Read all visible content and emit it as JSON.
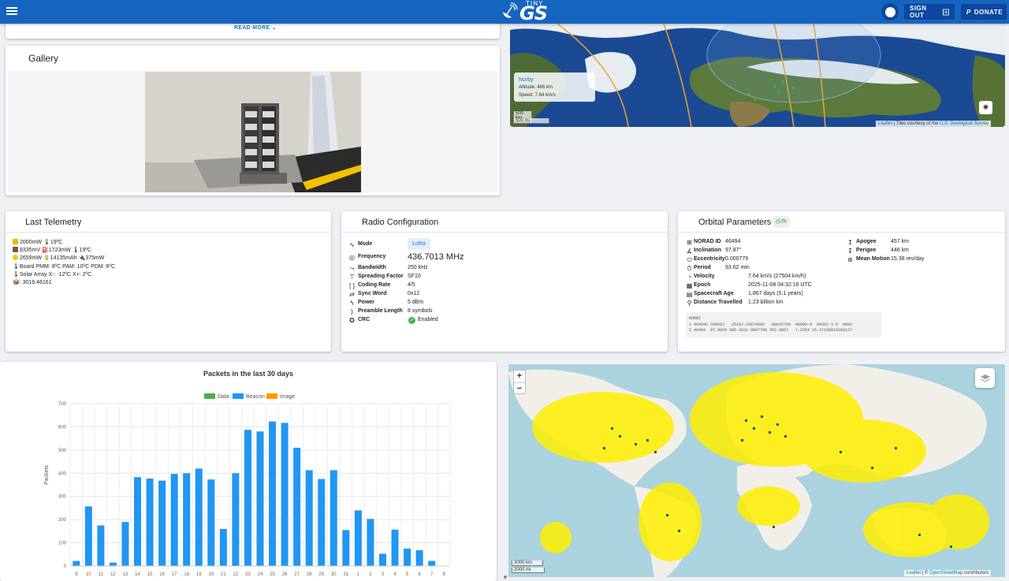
{
  "topbar": {
    "logo_top": "TINY",
    "logo_main": "GS",
    "signout_label": "SIGN OUT",
    "donate_label": "DONATE"
  },
  "description_card": {
    "read_more": "READ MORE ⌄"
  },
  "gallery": {
    "title": "Gallery"
  },
  "tracker_map": {
    "popup": {
      "name": "Norby",
      "altitude": "Altitude: 466 km",
      "speed": "Speed: 7.64 km/s"
    },
    "scale_km": "500 km",
    "scale_mi": "500 mi",
    "attribution_link": "Leaflet",
    "attribution_text": " | Tiles courtesy of the ",
    "attribution_link2": "U.S. Geological Survey"
  },
  "telemetry": {
    "title": "Last Telemetry",
    "rows": [
      "2000mW 🌡19ºC",
      "8335mV ⛽1723mW 🌡19ºC",
      "2659mW 🔋14135mAh 🔌375mW",
      "🌡Board PMM: 8ºC PAM: 10ºC PDM: 6ºC",
      "🌡Solar Array X-: -12ºC X+: 2ºC",
      "📦: 3019.46161"
    ]
  },
  "radio": {
    "title": "Radio Configuration",
    "mode_label": "Mode",
    "mode_value": "LoRa",
    "frequency_label": "Frequency",
    "frequency_value": "436.7013 MHz",
    "bandwidth_label": "Bandwidth",
    "bandwidth_value": "250 kHz",
    "sf_label": "Spreading Factor",
    "sf_value": "SF10",
    "cr_label": "Coding Rate",
    "cr_value": "4/5",
    "sync_label": "Sync Word",
    "sync_value": "0x12",
    "power_label": "Power",
    "power_value": "5 dBm",
    "preamble_label": "Preamble Length",
    "preamble_value": "8 symbols",
    "crc_label": "CRC",
    "crc_value": "Enabled"
  },
  "orbital": {
    "title": "Orbital Parameters",
    "age_badge": "7h",
    "norad_label": "NORAD ID",
    "norad_value": "46494",
    "incl_label": "Inclination",
    "incl_value": "97.87°",
    "ecc_label": "Eccentricity",
    "ecc_value": "0.000779",
    "period_label": "Period",
    "period_value": "93.62 min",
    "velocity_label": "Velocity",
    "velocity_value": "7.64 km/s (27504 km/h)",
    "epoch_label": "Epoch",
    "epoch_value": "2025-11-08 04:32:16 UTC",
    "age_label": "Spacecraft Age",
    "age_value": "1,867 days (5.1 years)",
    "dist_label": "Distance Travelled",
    "dist_value": "1.23 billion km",
    "apogee_label": "Apogee",
    "apogee_value": "457 km",
    "perigee_label": "Perigee",
    "perigee_value": "446 km",
    "motion_label": "Mean Motion",
    "motion_value": "15.38 rev/day",
    "tle": "NORBI\n1 46494U 20068J   25312.23074662  .00035709  00000-0  84362-3 0  9993\n2 46494  97.8669 305.3631 0007788 352.8867   7.2264 15.37150815282127"
  },
  "chart_data": {
    "type": "bar",
    "title": "Packets in the last 30 days",
    "ylabel": "Packets",
    "xlabel": "",
    "ylim": [
      0,
      700
    ],
    "yticks": [
      0,
      100,
      200,
      300,
      400,
      500,
      600,
      700
    ],
    "legend_position": "top",
    "categories": [
      "9",
      "10",
      "11",
      "12",
      "13",
      "14",
      "15",
      "16",
      "17",
      "18",
      "19",
      "20",
      "21",
      "22",
      "23",
      "24",
      "25",
      "26",
      "27",
      "28",
      "29",
      "30",
      "31",
      "1",
      "2",
      "3",
      "4",
      "5",
      "6",
      "7",
      "8"
    ],
    "series": [
      {
        "name": "Data",
        "color": "#4caf50",
        "values": [
          0,
          0,
          0,
          0,
          0,
          0,
          0,
          0,
          0,
          0,
          0,
          0,
          0,
          0,
          0,
          0,
          0,
          0,
          0,
          0,
          0,
          0,
          0,
          0,
          0,
          0,
          0,
          0,
          0,
          0,
          0
        ]
      },
      {
        "name": "Beacon",
        "color": "#2196f3",
        "values": [
          22,
          257,
          175,
          15,
          190,
          383,
          377,
          368,
          397,
          400,
          420,
          373,
          160,
          400,
          587,
          580,
          623,
          617,
          510,
          413,
          375,
          413,
          155,
          240,
          203,
          53,
          157,
          75,
          68,
          22,
          0
        ]
      },
      {
        "name": "Image",
        "color": "#ff9800",
        "values": [
          0,
          0,
          0,
          0,
          0,
          0,
          0,
          0,
          0,
          0,
          0,
          0,
          0,
          0,
          0,
          0,
          0,
          0,
          0,
          0,
          0,
          0,
          0,
          0,
          0,
          0,
          0,
          0,
          0,
          0,
          0
        ]
      }
    ]
  },
  "coverage_map": {
    "zoom_in": "+",
    "zoom_out": "−",
    "scale_km": "3000 km",
    "scale_mi": "2000 mi",
    "attribution_link": "Leaflet",
    "attribution_text": " | © ",
    "attribution_link2": "OpenStreetMap",
    "attribution_tail": " contributors"
  }
}
